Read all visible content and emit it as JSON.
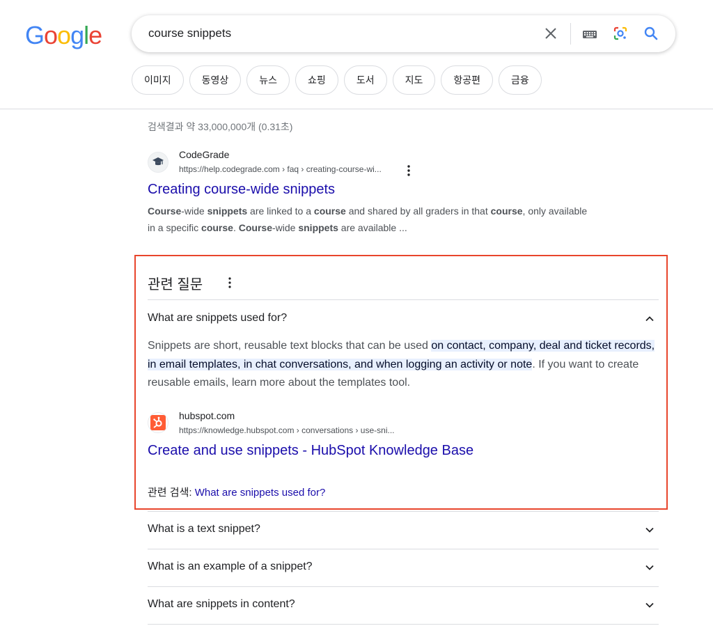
{
  "logo": {
    "letters": [
      "G",
      "o",
      "o",
      "g",
      "l",
      "e"
    ],
    "colors": [
      "#4285F4",
      "#EA4335",
      "#FBBC05",
      "#4285F4",
      "#34A853",
      "#EA4335"
    ]
  },
  "search": {
    "query": "course snippets"
  },
  "chips": [
    "이미지",
    "동영상",
    "뉴스",
    "쇼핑",
    "도서",
    "지도",
    "항공편",
    "금융"
  ],
  "result_stats": "검색결과 약 33,000,000개 (0.31초)",
  "result": {
    "site_name": "CodeGrade",
    "url": "https://help.codegrade.com › faq › creating-course-wi...",
    "title": "Creating course-wide snippets",
    "snippet_line1": [
      {
        "t": "Course",
        "b": true
      },
      {
        "t": "-wide ",
        "b": false
      },
      {
        "t": "snippets",
        "b": true
      },
      {
        "t": " are linked to a ",
        "b": false
      },
      {
        "t": "course",
        "b": true
      },
      {
        "t": " and shared by all graders in that ",
        "b": false
      },
      {
        "t": "course",
        "b": true
      },
      {
        "t": ", only available",
        "b": false
      }
    ],
    "snippet_line2": [
      {
        "t": "in a specific ",
        "b": false
      },
      {
        "t": "course",
        "b": true
      },
      {
        "t": ". ",
        "b": false
      },
      {
        "t": "Course",
        "b": true
      },
      {
        "t": "-wide ",
        "b": false
      },
      {
        "t": "snippets",
        "b": true
      },
      {
        "t": " are available ...",
        "b": false
      }
    ]
  },
  "paa": {
    "title": "관련 질문",
    "expanded": {
      "question": "What are snippets used for?",
      "answer_pre": "Snippets are short, reusable text blocks that can be used ",
      "answer_highlight": "on contact, company, deal and ticket records, in email templates, in chat conversations, and when logging an activity or note",
      "answer_post": ". If you want to create reusable emails, learn more about the templates tool.",
      "site_name": "hubspot.com",
      "url": "https://knowledge.hubspot.com › conversations › use-sni...",
      "title": "Create and use snippets - HubSpot Knowledge Base",
      "related_label": "관련 검색: ",
      "related_link": "What are snippets used for?"
    },
    "questions": [
      "What is a text snippet?",
      "What is an example of a snippet?",
      "What are snippets in content?"
    ]
  },
  "colors": {
    "link": "#1a0dab",
    "highlight": "#e8f0fe",
    "annotation_box": "#e8452c"
  }
}
